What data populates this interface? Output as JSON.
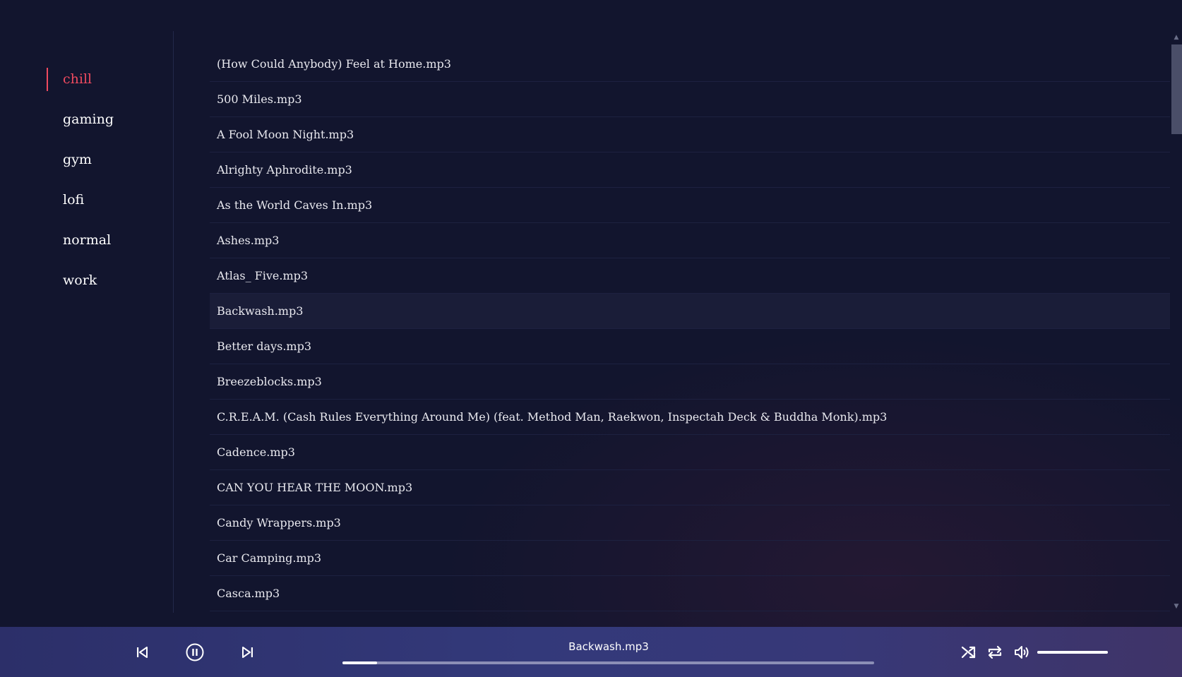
{
  "playlists": {
    "items": [
      {
        "label": "chill",
        "active": true
      },
      {
        "label": "gaming",
        "active": false
      },
      {
        "label": "gym",
        "active": false
      },
      {
        "label": "lofi",
        "active": false
      },
      {
        "label": "normal",
        "active": false
      },
      {
        "label": "work",
        "active": false
      }
    ]
  },
  "tracks": [
    "(How Could Anybody) Feel at Home.mp3",
    "500 Miles.mp3",
    "A Fool Moon Night.mp3",
    "Alrighty Aphrodite.mp3",
    "As the World Caves In.mp3",
    "Ashes.mp3",
    "Atlas_ Five.mp3",
    "Backwash.mp3",
    "Better days.mp3",
    "Breezeblocks.mp3",
    "C.R.E.A.M. (Cash Rules Everything Around Me) (feat. Method Man, Raekwon, Inspectah Deck & Buddha Monk).mp3",
    "Cadence.mp3",
    "CAN YOU HEAR THE MOON.mp3",
    "Candy Wrappers.mp3",
    "Car Camping.mp3",
    "Casca.mp3"
  ],
  "current_track_index": 7,
  "player": {
    "now_playing": "Backwash.mp3",
    "progress_fraction": 0.065,
    "volume_fraction": 1.0,
    "state": "playing",
    "icons": {
      "previous": "skip-previous-icon",
      "pause": "pause-icon",
      "next": "skip-next-icon",
      "shuffle": "shuffle-icon",
      "repeat": "repeat-icon",
      "volume": "volume-icon"
    }
  },
  "colors": {
    "accent": "#ef4a5f",
    "background": "#12152e",
    "player_bar": "#33397a"
  }
}
